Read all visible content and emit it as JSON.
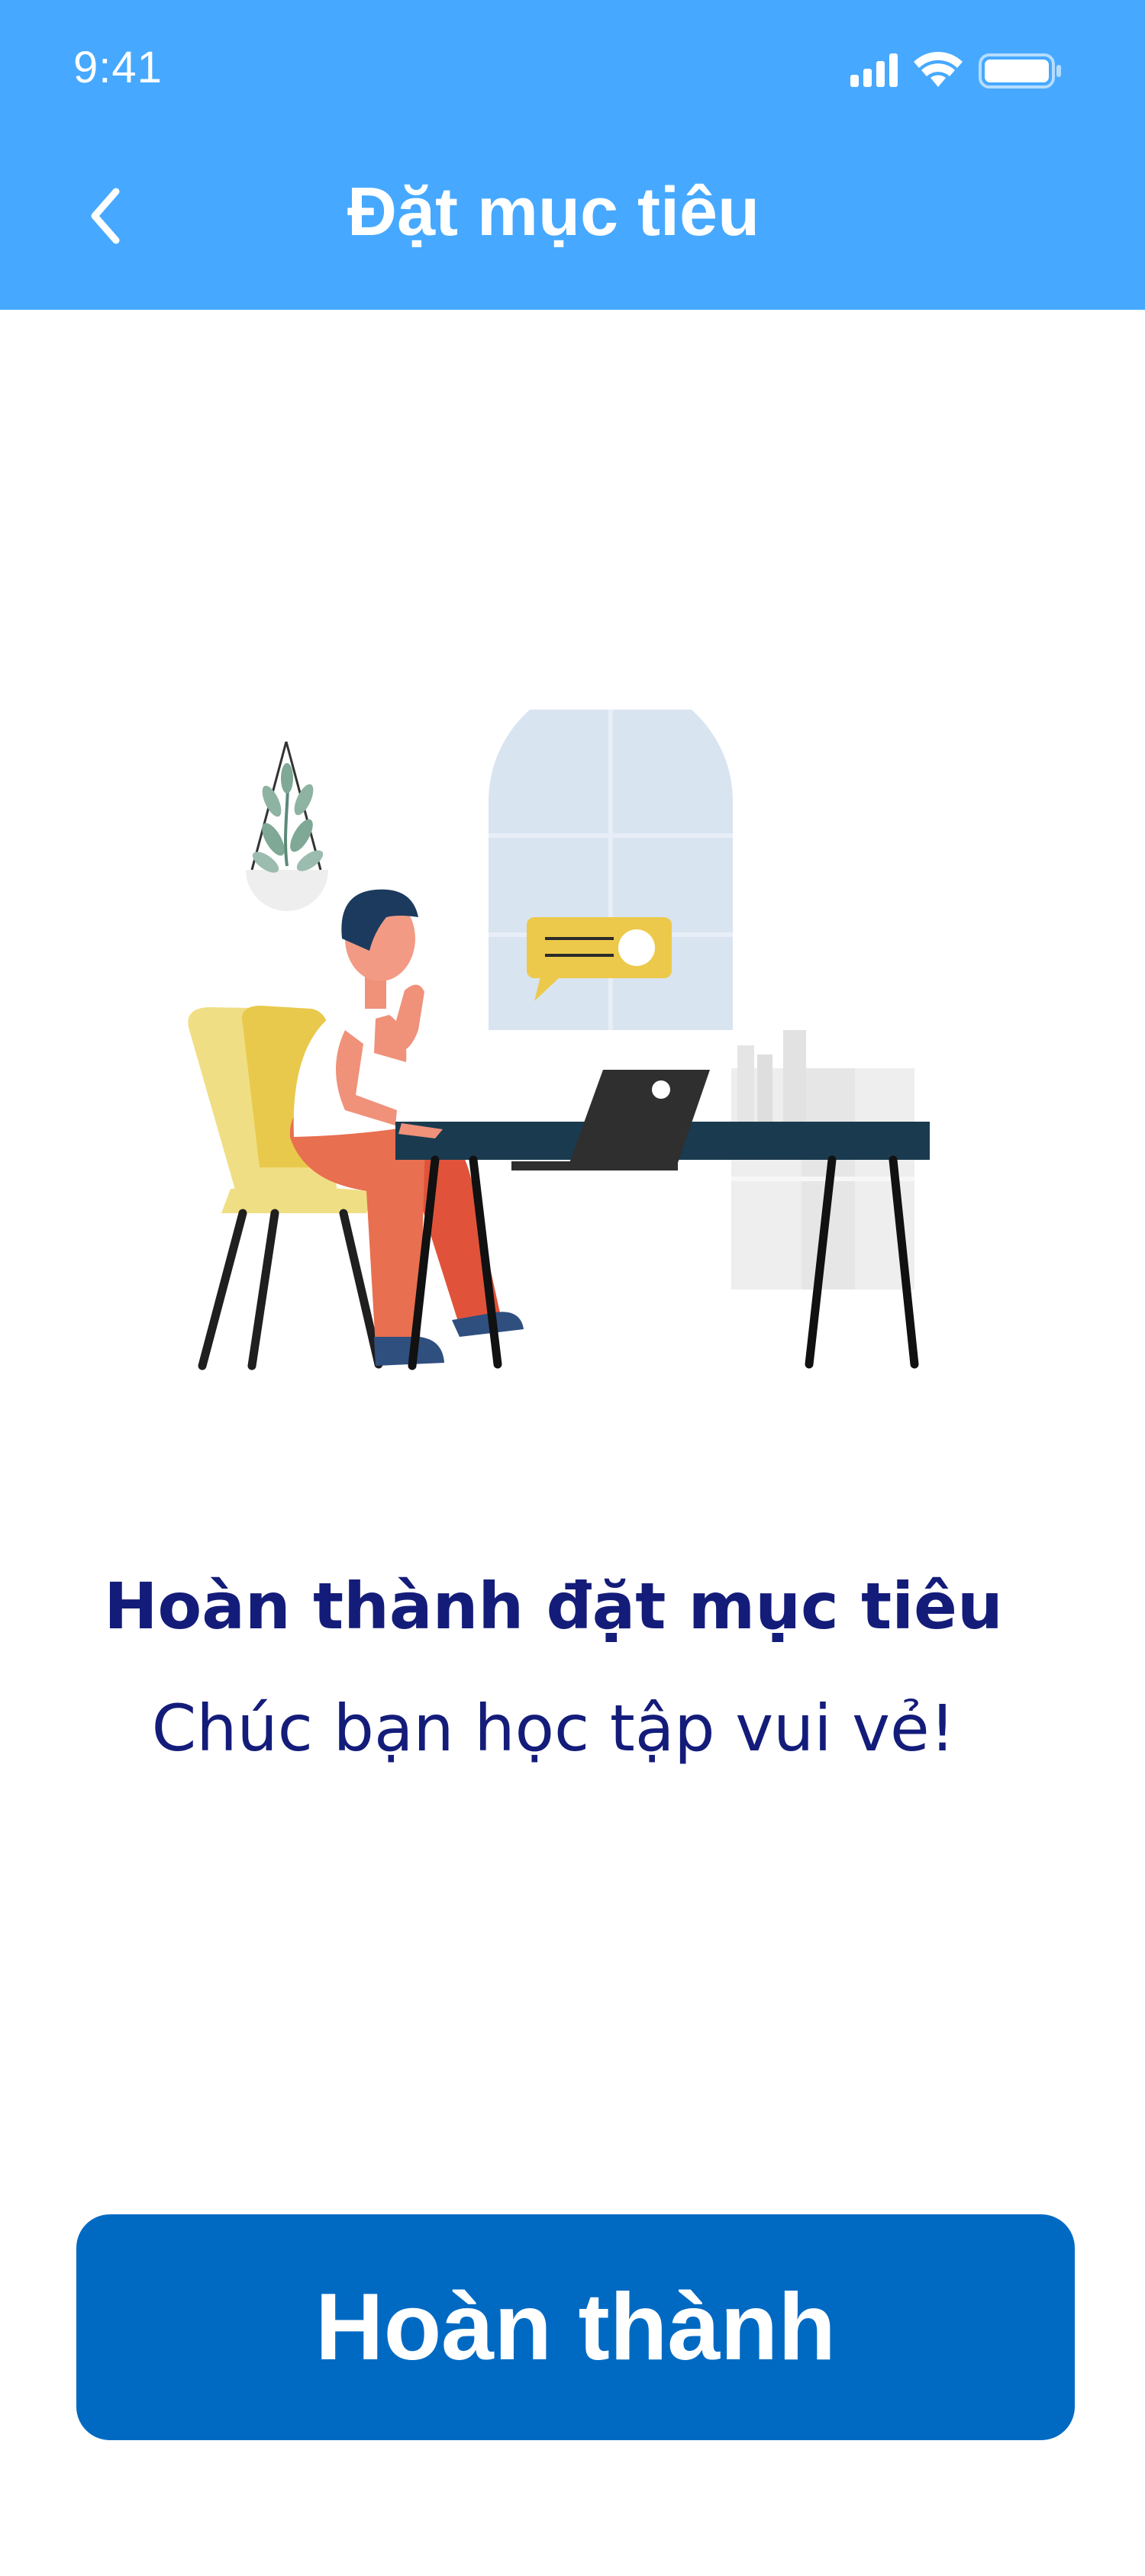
{
  "status_bar": {
    "time": "9:41",
    "icons": [
      "signal-icon",
      "wifi-icon",
      "battery-icon"
    ]
  },
  "header": {
    "title": "Đặt mục tiêu",
    "back_icon": "chevron-left-icon",
    "background_color": "#46a9ff"
  },
  "illustration": {
    "subject": "person-working-at-laptop-illustration"
  },
  "message": {
    "headline": "Hoàn thành đặt mục tiêu",
    "subline": "Chúc bạn học tập vui vẻ!",
    "color": "#141c7a"
  },
  "primary_button": {
    "label": "Hoàn thành",
    "color": "#006ac3"
  }
}
